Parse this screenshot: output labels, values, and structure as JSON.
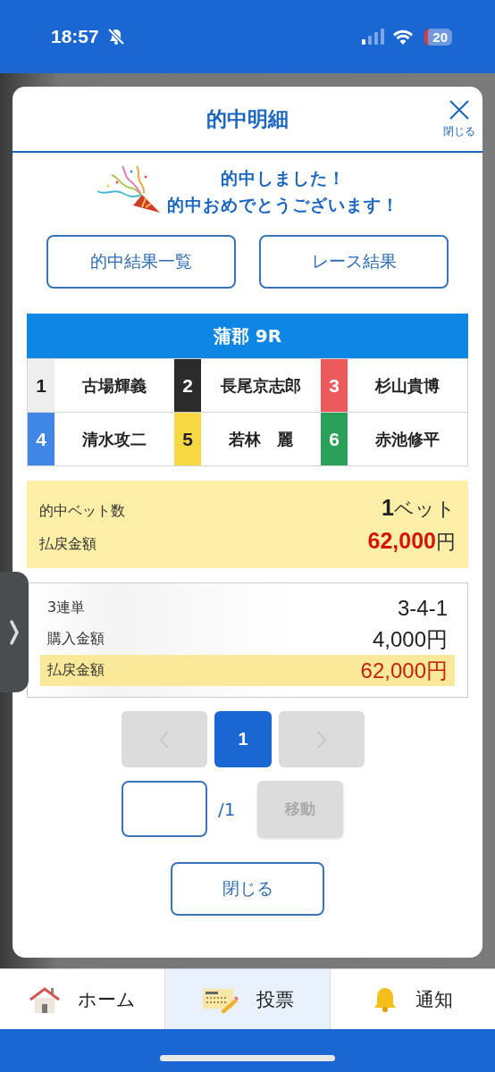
{
  "status_bar": {
    "time": "18:57",
    "battery": "20"
  },
  "modal": {
    "title": "的中明細",
    "close_label": "閉じる",
    "message": [
      "的中しました！",
      "的中おめでとうございます！"
    ],
    "links": [
      "的中結果一覧",
      "レース結果"
    ],
    "race": {
      "title": "蒲郡 9R",
      "racers": [
        {
          "number": "1",
          "name": "古場輝義",
          "color": "#eeeeee"
        },
        {
          "number": "2",
          "name": "長尾京志郎",
          "color": "#2b2b2b"
        },
        {
          "number": "3",
          "name": "杉山貴博",
          "color": "#ec5a5e"
        },
        {
          "number": "4",
          "name": "清水攻二",
          "color": "#3f86e6"
        },
        {
          "number": "5",
          "name": "若林　麗",
          "color": "#f7d842"
        },
        {
          "number": "6",
          "name": "赤池修平",
          "color": "#2aa05a"
        }
      ]
    },
    "summary": {
      "bets_label": "的中ベット数",
      "bets_count": "1",
      "bets_unit": "ベット",
      "payout_label": "払戻金額",
      "payout_amount": "62,000",
      "payout_unit": "円"
    },
    "tickets": [
      {
        "type_label": "3連単",
        "combination": "3-4-1",
        "purchase_label": "購入金額",
        "purchase_amount": "4,000円",
        "payout_label": "払戻金額",
        "payout_amount": "62,000円"
      }
    ],
    "pagination": {
      "prev_disabled": true,
      "next_disabled": true,
      "pages": [
        {
          "label": "1",
          "selected": true
        }
      ],
      "total": "/1",
      "go_label": "移動"
    },
    "close_button": "閉じる"
  },
  "bottom_nav": [
    {
      "label": "ホーム",
      "kind": "home",
      "selected": false
    },
    {
      "label": "投票",
      "kind": "vote",
      "selected": true
    },
    {
      "label": "通知",
      "kind": "bell",
      "selected": false
    }
  ]
}
